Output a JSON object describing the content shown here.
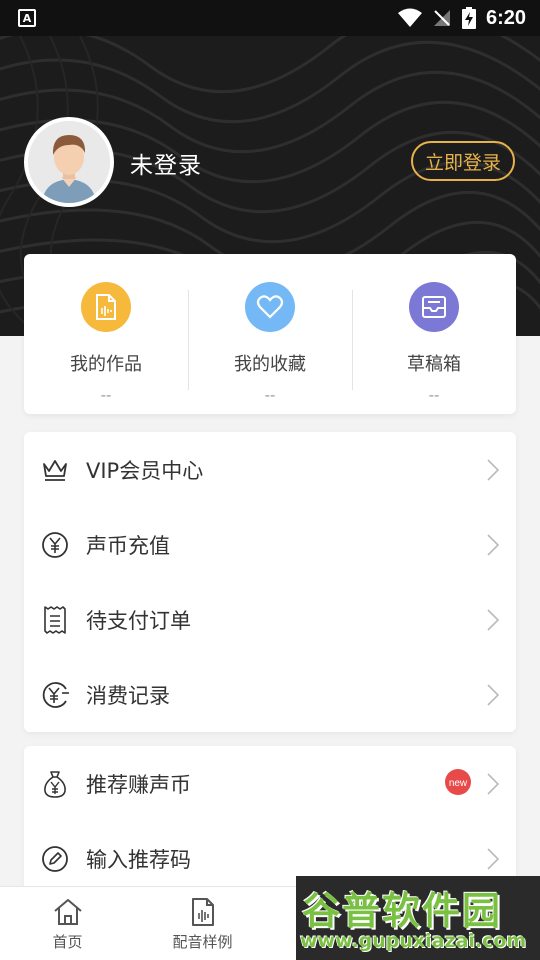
{
  "status_bar": {
    "left_badge": "A",
    "time": "6:20",
    "icons": [
      "wifi-icon",
      "no-signal-icon",
      "battery-charging-icon"
    ]
  },
  "profile": {
    "username": "未登录",
    "login_button": "立即登录"
  },
  "quick_actions": [
    {
      "label": "我的作品",
      "count": "--",
      "icon": "document-audio-icon",
      "color": "#f6b93b"
    },
    {
      "label": "我的收藏",
      "count": "--",
      "icon": "heart-icon",
      "color": "#74b9f5"
    },
    {
      "label": "草稿箱",
      "count": "--",
      "icon": "inbox-icon",
      "color": "#7c78d6"
    }
  ],
  "menu_primary": [
    {
      "label": "VIP会员中心",
      "icon": "crown-icon"
    },
    {
      "label": "声币充值",
      "icon": "yuan-coin-icon"
    },
    {
      "label": "待支付订单",
      "icon": "receipt-icon"
    },
    {
      "label": "消费记录",
      "icon": "yuan-history-icon"
    }
  ],
  "menu_secondary": [
    {
      "label": "推荐赚声币",
      "icon": "money-bag-icon",
      "badge": "new"
    },
    {
      "label": "输入推荐码",
      "icon": "pencil-circle-icon"
    }
  ],
  "bottom_nav": [
    {
      "label": "首页",
      "icon": "home-icon"
    },
    {
      "label": "配音样例",
      "icon": "audio-file-icon"
    }
  ],
  "watermark": {
    "title": "谷普软件园",
    "url": "www.gupuxiazai.com"
  },
  "colors": {
    "header_bg": "#1c1c1c",
    "accent_gold": "#e8b24a",
    "badge_red": "#e84a4a"
  }
}
